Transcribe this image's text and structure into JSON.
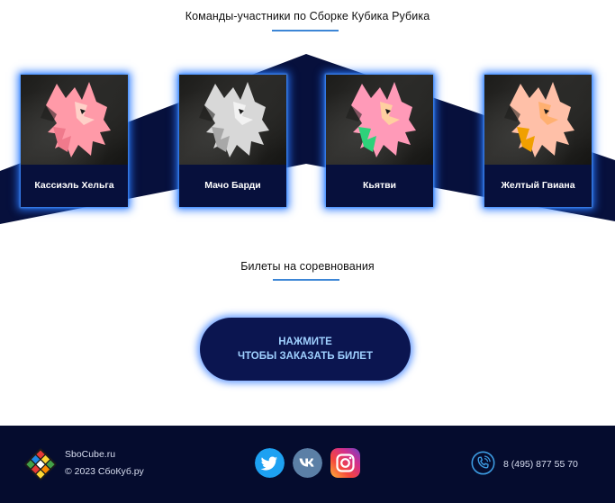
{
  "teams_section": {
    "title": "Команды-участники по Сборке Кубика Рубика",
    "teams": [
      {
        "name": "Кассиэль Хельга",
        "emblem_colors": [
          "#ff9aa8",
          "#ffd0c8",
          "#f07a8c"
        ]
      },
      {
        "name": "Мачо Барди",
        "emblem_colors": [
          "#d8d8d8",
          "#f2f2f2",
          "#a8a8a8"
        ]
      },
      {
        "name": "Кьятви",
        "emblem_colors": [
          "#ff9ab8",
          "#ffcfa0",
          "#2ed27a"
        ]
      },
      {
        "name": "Желтый Гвиана",
        "emblem_colors": [
          "#ffc0a8",
          "#ffb070",
          "#f0a000"
        ]
      }
    ]
  },
  "tickets_section": {
    "title": "Билеты на соревнования",
    "button_line1": "НАЖМИТЕ",
    "button_line2": "ЧТОБЫ ЗАКАЗАТЬ БИЛЕТ"
  },
  "footer": {
    "site_name": "SboCube.ru",
    "copyright": "© 2023 СбоКуб.ру",
    "social": [
      "twitter-icon",
      "vk-icon",
      "instagram-icon"
    ],
    "phone": "8 (495) 877 55 70"
  },
  "colors": {
    "accent": "#3c86d6",
    "navy": "#07103c",
    "footer_bg": "#050c2e",
    "button_text": "#9fd0ff"
  }
}
